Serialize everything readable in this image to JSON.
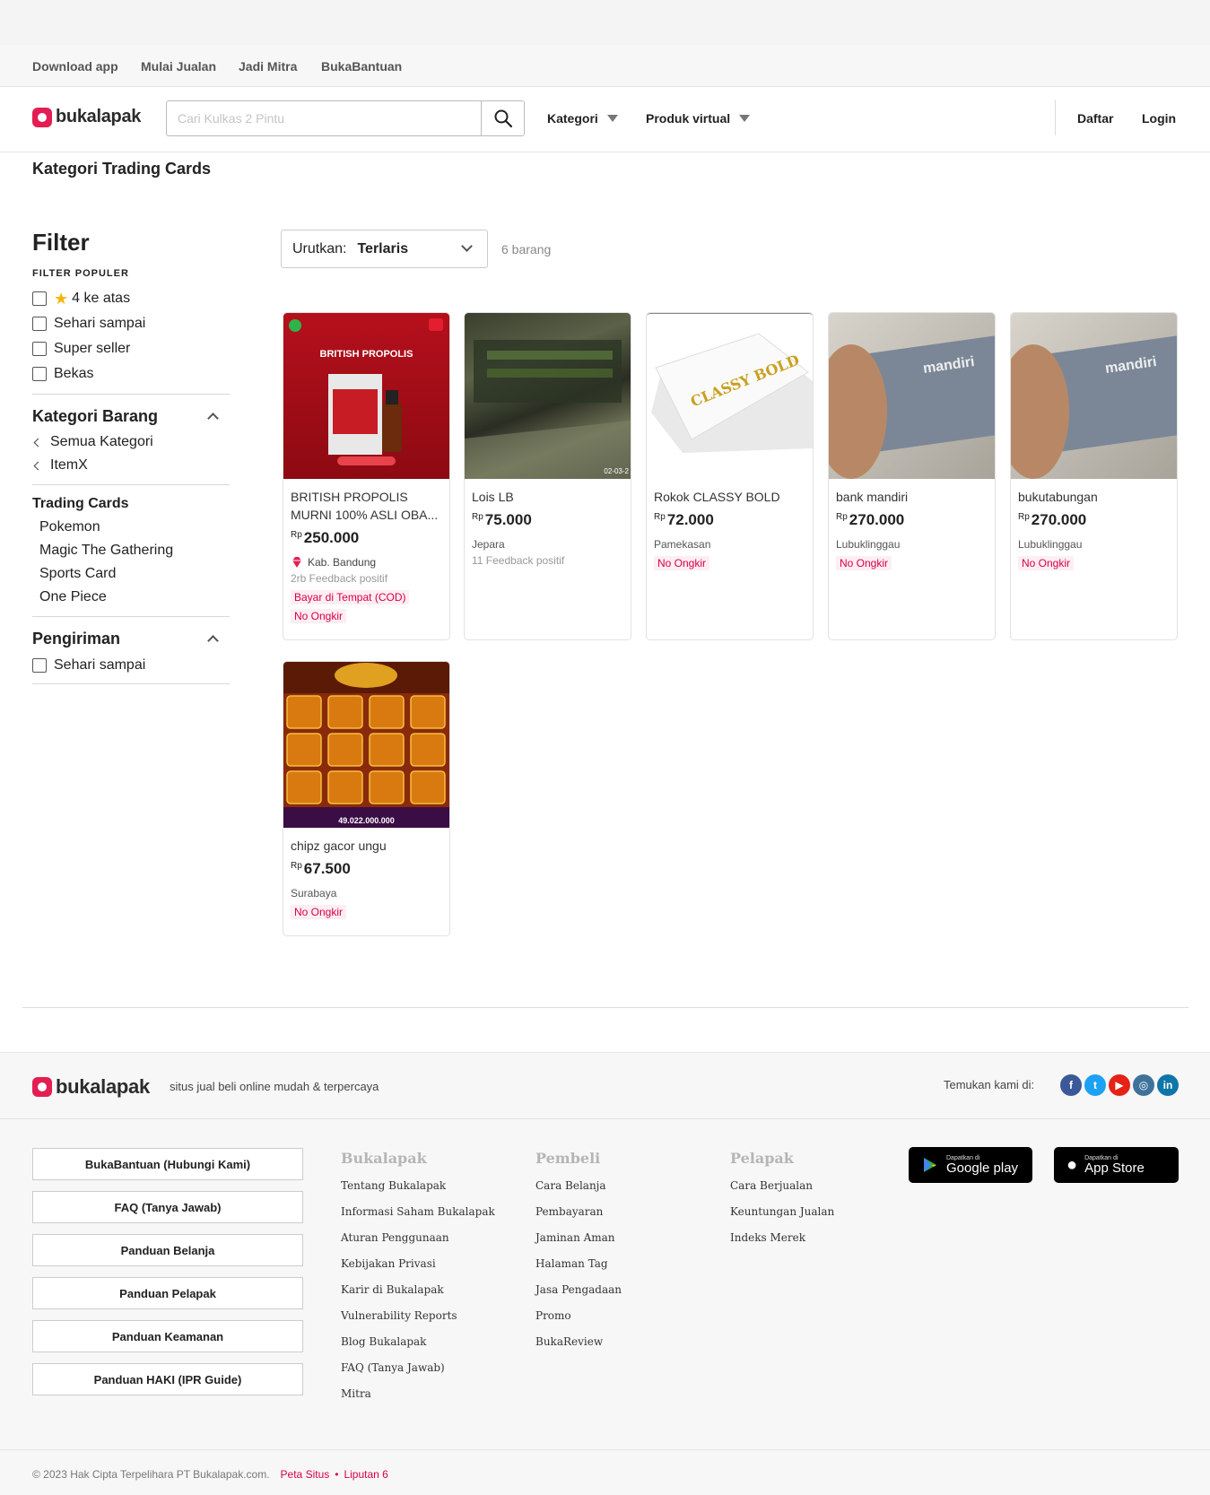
{
  "topbar": {
    "links": [
      "Download app",
      "Mulai Jualan",
      "Jadi Mitra",
      "BukaBantuan"
    ]
  },
  "header": {
    "logo_text": "bukalapak",
    "search_placeholder": "Cari Kulkas 2 Pintu",
    "kategori_label": "Kategori",
    "produk_virtual_label": "Produk virtual",
    "daftar_label": "Daftar",
    "login_label": "Login"
  },
  "page_title": "Kategori Trading Cards",
  "filter": {
    "title": "Filter",
    "popular_label": "FILTER POPULER",
    "popular_items": [
      "4 ke atas",
      "Sehari sampai",
      "Super seller",
      "Bekas"
    ],
    "kategori_title": "Kategori Barang",
    "kategori_back": [
      "Semua Kategori",
      "ItemX"
    ],
    "kategori_current": "Trading Cards",
    "kategori_sub": [
      "Pokemon",
      "Magic The Gathering",
      "Sports Card",
      "One Piece"
    ],
    "pengiriman_title": "Pengiriman",
    "pengiriman_items": [
      "Sehari sampai"
    ]
  },
  "sort": {
    "label": "Urutkan:",
    "value": "Terlaris",
    "count": "6 barang"
  },
  "products": [
    {
      "name": "BRITISH PROPOLIS MURNI 100% ASLI OBA...",
      "currency": "Rp",
      "price": "250.000",
      "location": "Kab. Bandung",
      "feedback": "2rb Feedback positif",
      "badges": [
        "Bayar di Tempat (COD)",
        "No Ongkir"
      ],
      "image_text": "BRITISH PROPOLIS"
    },
    {
      "name": "Lois LB",
      "currency": "Rp",
      "price": "75.000",
      "location": "Jepara",
      "feedback": "11 Feedback positif",
      "badges": [],
      "image_text": "02-03-2"
    },
    {
      "name": "Rokok CLASSY BOLD",
      "currency": "Rp",
      "price": "72.000",
      "location": "Pamekasan",
      "feedback": "",
      "badges": [
        "No Ongkir"
      ],
      "image_text": "CLASSY BOLD"
    },
    {
      "name": "bank mandiri",
      "currency": "Rp",
      "price": "270.000",
      "location": "Lubuklinggau",
      "feedback": "",
      "badges": [
        "No Ongkir"
      ],
      "image_text": "mandiri"
    },
    {
      "name": "bukutabungan",
      "currency": "Rp",
      "price": "270.000",
      "location": "Lubuklinggau",
      "feedback": "",
      "badges": [
        "No Ongkir"
      ],
      "image_text": "mandiri"
    },
    {
      "name": "chipz gacor ungu",
      "currency": "Rp",
      "price": "67.500",
      "location": "Surabaya",
      "feedback": "",
      "badges": [
        "No Ongkir"
      ],
      "image_text": "49.022.000.000"
    }
  ],
  "footer": {
    "logo_text": "bukalapak",
    "tagline": "situs jual beli online mudah & terpercaya",
    "temukan": "Temukan kami di:",
    "social": [
      {
        "name": "facebook",
        "glyph": "f",
        "color": "#3b5998"
      },
      {
        "name": "twitter",
        "glyph": "t",
        "color": "#1da1f2"
      },
      {
        "name": "youtube",
        "glyph": "▶",
        "color": "#e62117"
      },
      {
        "name": "instagram",
        "glyph": "◎",
        "color": "#3f729b"
      },
      {
        "name": "linkedin",
        "glyph": "in",
        "color": "#0e76a8"
      }
    ],
    "buttons": [
      "BukaBantuan (Hubungi Kami)",
      "FAQ (Tanya Jawab)",
      "Panduan Belanja",
      "Panduan Pelapak",
      "Panduan Keamanan",
      "Panduan HAKI (IPR Guide)"
    ],
    "columns": [
      {
        "title": "Bukalapak",
        "links": [
          "Tentang Bukalapak",
          "Informasi Saham Bukalapak",
          "Aturan Penggunaan",
          "Kebijakan Privasi",
          "Karir di Bukalapak",
          "Vulnerability Reports",
          "Blog Bukalapak",
          "FAQ (Tanya Jawab)",
          "Mitra"
        ]
      },
      {
        "title": "Pembeli",
        "links": [
          "Cara Belanja",
          "Pembayaran",
          "Jaminan Aman",
          "Halaman Tag",
          "Jasa Pengadaan",
          "Promo",
          "BukaReview"
        ]
      },
      {
        "title": "Pelapak",
        "links": [
          "Cara Berjualan",
          "Keuntungan Jualan",
          "Indeks Merek"
        ]
      }
    ],
    "stores": [
      {
        "small": "Dapatkan di",
        "big": "Google play"
      },
      {
        "small": "Dapatkan di",
        "big": "App Store"
      }
    ],
    "copyright": "© 2023 Hak Cipta Terpelihara PT Bukalapak.com.",
    "peta_situs": "Peta Situs",
    "liputan": "Liputan 6"
  },
  "colors": {
    "brand": "#e31e52",
    "badge_text": "#d7004a",
    "badge_bg": "#fdeef2"
  }
}
